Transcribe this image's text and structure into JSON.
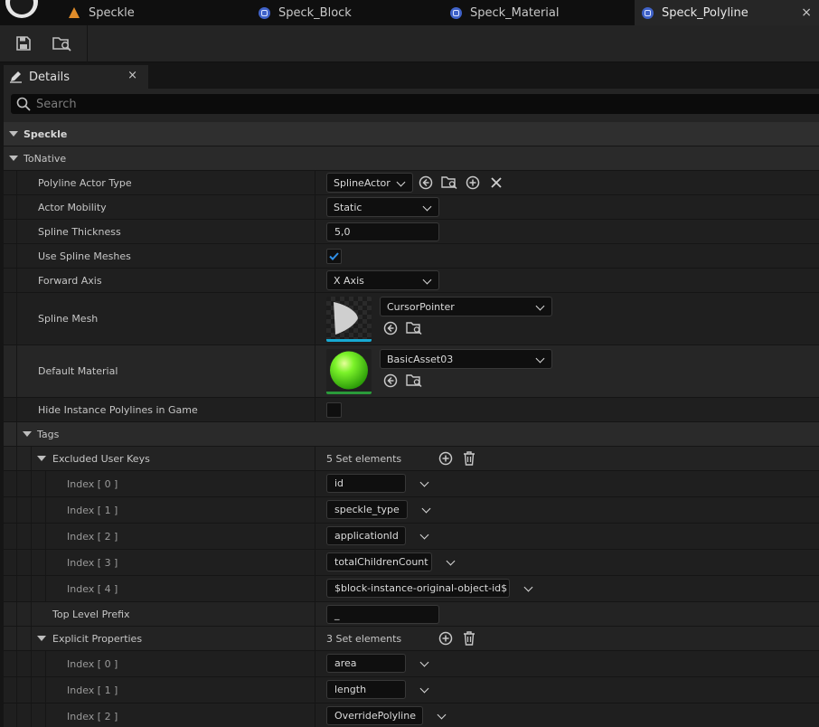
{
  "tabs": [
    {
      "label": "Speckle",
      "icon": "unreal-level-icon",
      "active": false
    },
    {
      "label": "Speck_Block",
      "icon": "blueprint-icon",
      "active": false
    },
    {
      "label": "Speck_Material",
      "icon": "blueprint-icon",
      "active": false
    },
    {
      "label": "Speck_Polyline",
      "icon": "blueprint-icon",
      "active": true
    }
  ],
  "tab_close": "×",
  "toolbar": {
    "save": "save-icon",
    "browse": "browse-icon"
  },
  "details": {
    "title": "Details",
    "close": "×",
    "search_placeholder": "Search"
  },
  "speckle": {
    "category": "Speckle",
    "tonative": "ToNative",
    "polyline_actor_type": {
      "label": "Polyline Actor Type",
      "value": "SplineActor"
    },
    "actor_mobility": {
      "label": "Actor Mobility",
      "value": "Static"
    },
    "spline_thickness": {
      "label": "Spline Thickness",
      "value": "5,0"
    },
    "use_spline_meshes": {
      "label": "Use Spline Meshes",
      "checked": true
    },
    "forward_axis": {
      "label": "Forward Axis",
      "value": "X Axis"
    },
    "spline_mesh": {
      "label": "Spline Mesh",
      "value": "CursorPointer"
    },
    "default_material": {
      "label": "Default Material",
      "value": "BasicAsset03"
    },
    "hide_instance": {
      "label": "Hide Instance Polylines in Game",
      "checked": false
    },
    "tags": "Tags",
    "excluded_user_keys": {
      "label": "Excluded User Keys",
      "count": "5 Set elements",
      "items": [
        {
          "index": "Index [ 0 ]",
          "value": "id"
        },
        {
          "index": "Index [ 1 ]",
          "value": "speckle_type"
        },
        {
          "index": "Index [ 2 ]",
          "value": "applicationId"
        },
        {
          "index": "Index [ 3 ]",
          "value": "totalChildrenCount"
        },
        {
          "index": "Index [ 4 ]",
          "value": "$block-instance-original-object-id$"
        }
      ]
    },
    "top_level_prefix": {
      "label": "Top Level Prefix",
      "value": "_"
    },
    "explicit_properties": {
      "label": "Explicit Properties",
      "count": "3 Set elements",
      "items": [
        {
          "index": "Index [ 0 ]",
          "value": "area"
        },
        {
          "index": "Index [ 1 ]",
          "value": "length"
        },
        {
          "index": "Index [ 2 ]",
          "value": "OverridePolyline"
        }
      ]
    }
  }
}
